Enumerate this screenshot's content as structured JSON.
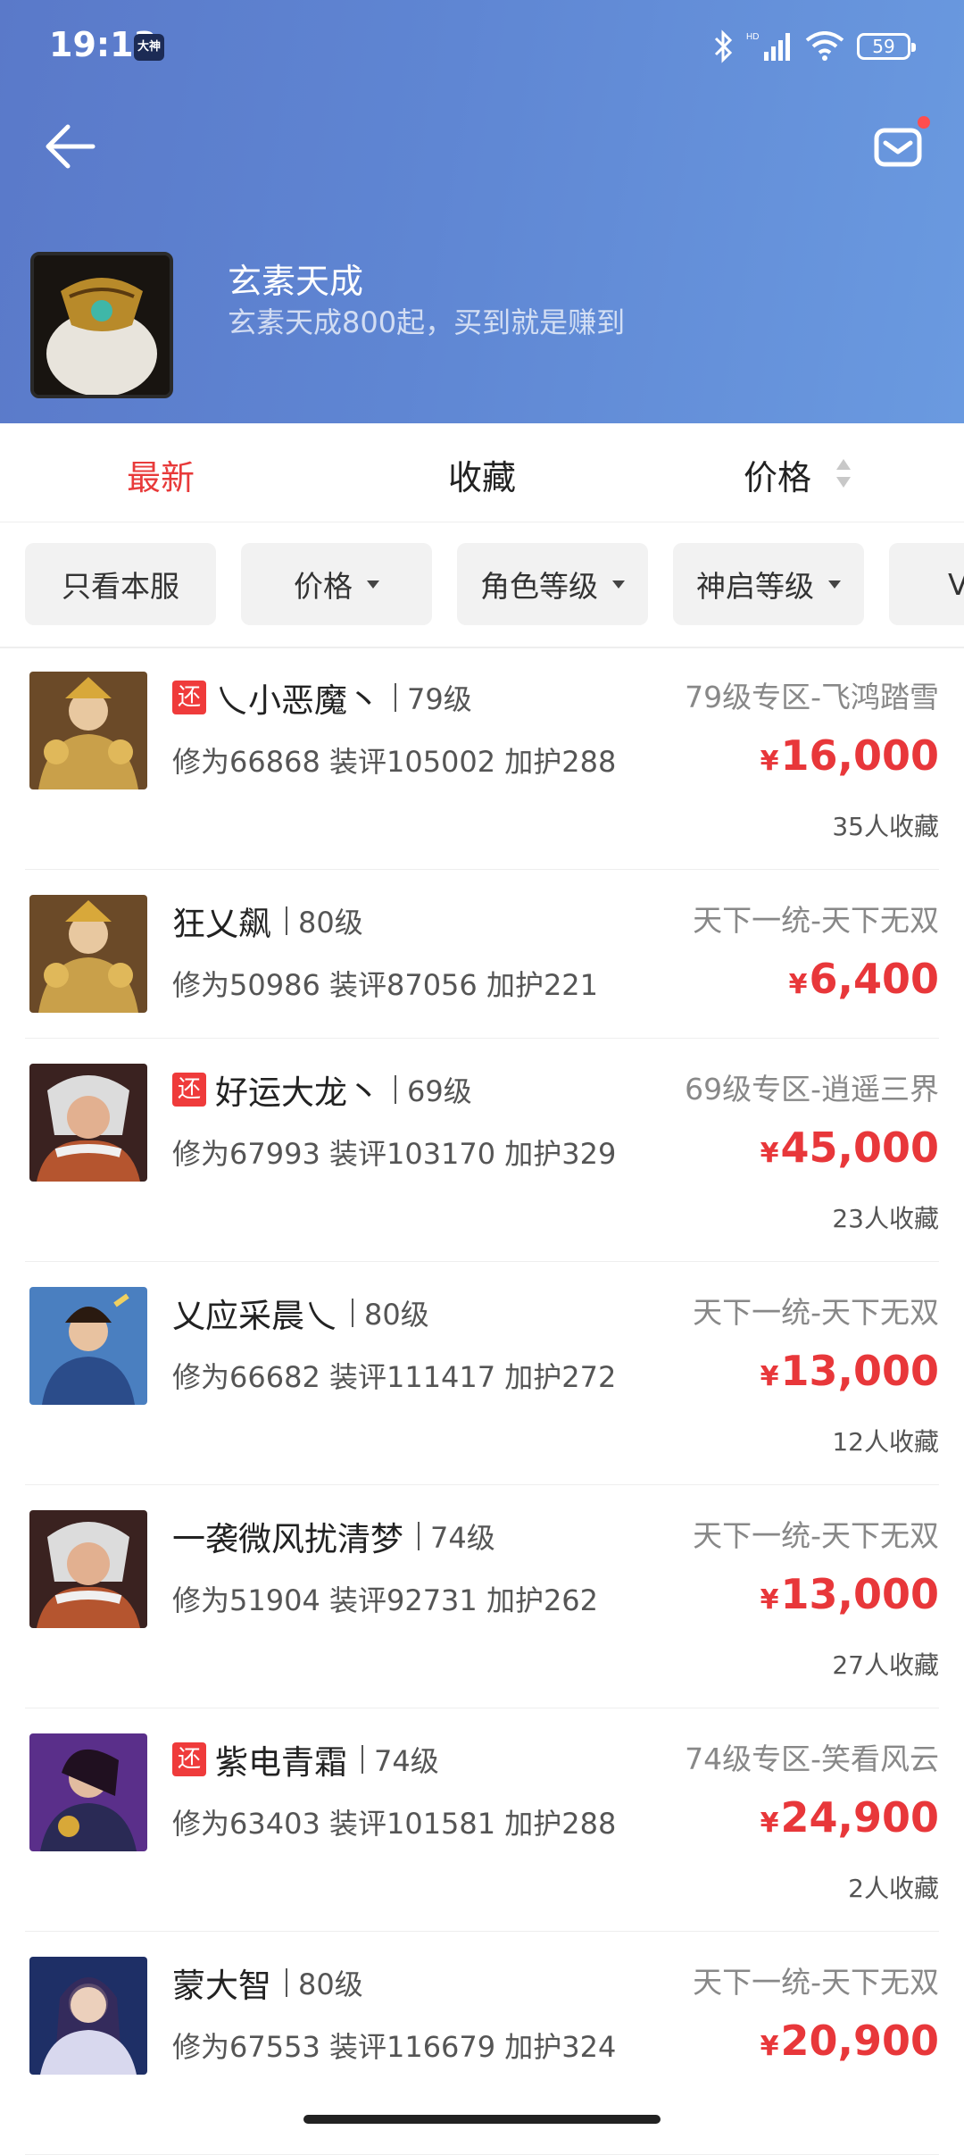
{
  "status_bar": {
    "time": "19:13",
    "app_badge": "大神",
    "battery": "59"
  },
  "header": {
    "title": "玄素天成",
    "subtitle": "玄素天成800起，买到就是赚到"
  },
  "tabs": {
    "latest": "最新",
    "favorites": "收藏",
    "price": "价格"
  },
  "filters": [
    "只看本服",
    "价格",
    "角色等级",
    "神启等级",
    "V"
  ],
  "items": [
    {
      "tag": "还",
      "name": "乀小恶魔丶",
      "level": "79级",
      "stats": "修为66868 装评105002 加护288",
      "server": "79级专区-飞鸿踏雪",
      "price_symbol": "¥",
      "price": "16,000",
      "fav": "35人收藏",
      "avatar_color": "#a07a30"
    },
    {
      "tag": "",
      "name": "狂乂飙",
      "level": "80级",
      "stats": "修为50986 装评87056 加护221",
      "server": "天下一统-天下无双",
      "price_symbol": "¥",
      "price": "6,400",
      "fav": "",
      "avatar_color": "#a07a30"
    },
    {
      "tag": "还",
      "name": "好运大龙丶",
      "level": "69级",
      "stats": "修为67993 装评103170 加护329",
      "server": "69级专区-逍遥三界",
      "price_symbol": "¥",
      "price": "45,000",
      "fav": "23人收藏",
      "avatar_color": "#b0552f"
    },
    {
      "tag": "",
      "name": "乂应采晨乀",
      "level": "80级",
      "stats": "修为66682 装评111417 加护272",
      "server": "天下一统-天下无双",
      "price_symbol": "¥",
      "price": "13,000",
      "fav": "12人收藏",
      "avatar_color": "#3b6fb0"
    },
    {
      "tag": "",
      "name": "一袭微风扰清梦",
      "level": "74级",
      "stats": "修为51904 装评92731 加护262",
      "server": "天下一统-天下无双",
      "price_symbol": "¥",
      "price": "13,000",
      "fav": "27人收藏",
      "avatar_color": "#b0552f"
    },
    {
      "tag": "还",
      "name": "紫电青霜",
      "level": "74级",
      "stats": "修为63403 装评101581 加护288",
      "server": "74级专区-笑看风云",
      "price_symbol": "¥",
      "price": "24,900",
      "fav": "2人收藏",
      "avatar_color": "#6a3a9a"
    },
    {
      "tag": "",
      "name": "蒙大智",
      "level": "80级",
      "stats": "修为67553 装评116679 加护324",
      "server": "天下一统-天下无双",
      "price_symbol": "¥",
      "price": "20,900",
      "fav": "",
      "avatar_color": "#2a3f80"
    }
  ]
}
